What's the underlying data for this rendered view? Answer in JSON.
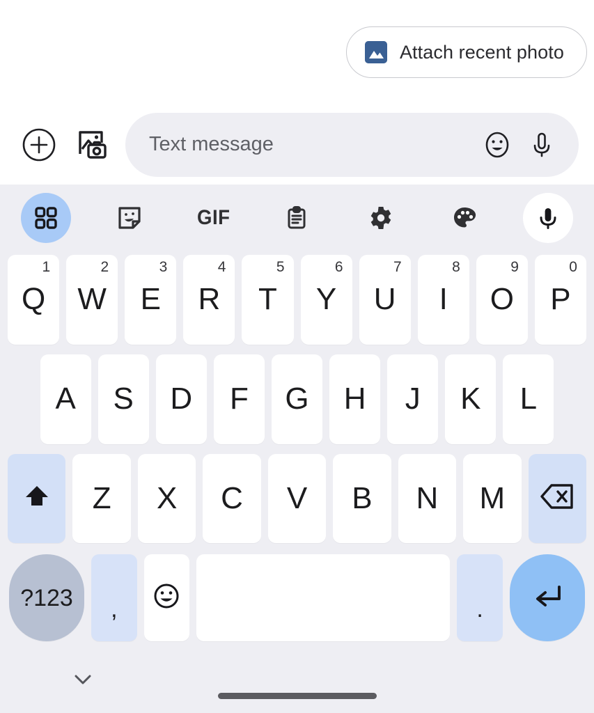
{
  "suggestion_chip": {
    "label": "Attach recent photo",
    "icon": "photo-image-icon",
    "icon_color": "#3a6094",
    "border_color": "#c8c9ce"
  },
  "compose_bar": {
    "plus_icon": "plus-circle-icon",
    "gallery_icon": "photo-camera-gallery-icon",
    "input_placeholder": "Text message",
    "input_value": "",
    "emoji_icon": "emoji-smiley-icon",
    "mic_icon": "microphone-icon",
    "field_background": "#eeeef3"
  },
  "keyboard": {
    "background": "#eeeef3",
    "key_color": "#ffffff",
    "accent_blue": "#a8caf7",
    "mod_key_color": "#d3e0f7",
    "toolbar": [
      {
        "name": "apps-grid-icon",
        "label": "",
        "state": "active"
      },
      {
        "name": "sticker-icon",
        "label": "",
        "state": "normal"
      },
      {
        "name": "gif-icon",
        "label": "GIF",
        "state": "normal"
      },
      {
        "name": "clipboard-icon",
        "label": "",
        "state": "normal"
      },
      {
        "name": "settings-gear-icon",
        "label": "",
        "state": "normal"
      },
      {
        "name": "theme-palette-icon",
        "label": "",
        "state": "normal"
      },
      {
        "name": "voice-mic-icon",
        "label": "",
        "state": "solid"
      }
    ],
    "row1": [
      {
        "letter": "Q",
        "number": "1"
      },
      {
        "letter": "W",
        "number": "2"
      },
      {
        "letter": "E",
        "number": "3"
      },
      {
        "letter": "R",
        "number": "4"
      },
      {
        "letter": "T",
        "number": "5"
      },
      {
        "letter": "Y",
        "number": "6"
      },
      {
        "letter": "U",
        "number": "7"
      },
      {
        "letter": "I",
        "number": "8"
      },
      {
        "letter": "O",
        "number": "9"
      },
      {
        "letter": "P",
        "number": "0"
      }
    ],
    "row2": [
      {
        "letter": "A"
      },
      {
        "letter": "S"
      },
      {
        "letter": "D"
      },
      {
        "letter": "F"
      },
      {
        "letter": "G"
      },
      {
        "letter": "H"
      },
      {
        "letter": "J"
      },
      {
        "letter": "K"
      },
      {
        "letter": "L"
      }
    ],
    "row3": [
      {
        "letter": "Z"
      },
      {
        "letter": "X"
      },
      {
        "letter": "C"
      },
      {
        "letter": "V"
      },
      {
        "letter": "B"
      },
      {
        "letter": "N"
      },
      {
        "letter": "M"
      }
    ],
    "shift_key": {
      "name": "shift-key",
      "icon": "shift-arrow-up-icon"
    },
    "backspace_key": {
      "name": "backspace-key",
      "icon": "backspace-delete-icon"
    },
    "bottom_row": {
      "symbols_label": "?123",
      "comma_label": ",",
      "emoji_icon": "emoji-smiley-icon",
      "space_label": "",
      "period_label": ".",
      "enter_icon": "enter-return-icon",
      "enter_color": "#8fc0f5",
      "symbols_color": "#b7c0d2"
    }
  },
  "nav_bar": {
    "hide_keyboard_icon": "chevron-down-icon",
    "gesture_pill": "home-gesture-bar"
  }
}
